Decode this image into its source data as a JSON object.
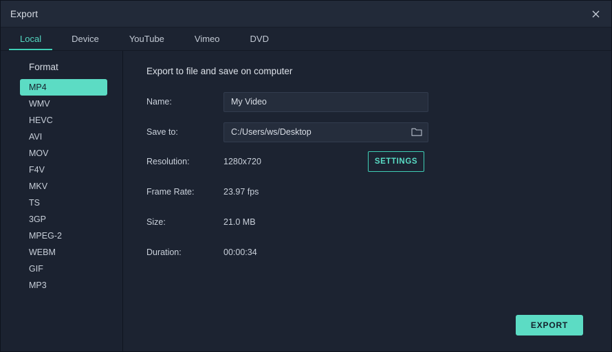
{
  "window": {
    "title": "Export",
    "close_icon": "close-icon",
    "accent_color": "#5cdcc4",
    "background_color": "#1c2331",
    "titlebar_color": "#222a39"
  },
  "tabs": [
    {
      "label": "Local",
      "active": true
    },
    {
      "label": "Device",
      "active": false
    },
    {
      "label": "YouTube",
      "active": false
    },
    {
      "label": "Vimeo",
      "active": false
    },
    {
      "label": "DVD",
      "active": false
    }
  ],
  "sidebar": {
    "title": "Format",
    "formats": [
      {
        "label": "MP4",
        "selected": true
      },
      {
        "label": "WMV",
        "selected": false
      },
      {
        "label": "HEVC",
        "selected": false
      },
      {
        "label": "AVI",
        "selected": false
      },
      {
        "label": "MOV",
        "selected": false
      },
      {
        "label": "F4V",
        "selected": false
      },
      {
        "label": "MKV",
        "selected": false
      },
      {
        "label": "TS",
        "selected": false
      },
      {
        "label": "3GP",
        "selected": false
      },
      {
        "label": "MPEG-2",
        "selected": false
      },
      {
        "label": "WEBM",
        "selected": false
      },
      {
        "label": "GIF",
        "selected": false
      },
      {
        "label": "MP3",
        "selected": false
      }
    ]
  },
  "main": {
    "heading": "Export to file and save on computer",
    "name": {
      "label": "Name:",
      "value": "My Video",
      "placeholder": "My Video"
    },
    "save_to": {
      "label": "Save to:",
      "value": "C:/Users/ws/Desktop",
      "placeholder": "C:/Users/ws/Desktop",
      "browse_icon": "folder-icon"
    },
    "resolution": {
      "label": "Resolution:",
      "value": "1280x720"
    },
    "settings_button": "SETTINGS",
    "frame_rate": {
      "label": "Frame Rate:",
      "value": "23.97 fps"
    },
    "size": {
      "label": "Size:",
      "value": "21.0 MB"
    },
    "duration": {
      "label": "Duration:",
      "value": "00:00:34"
    },
    "export_button": "EXPORT"
  }
}
